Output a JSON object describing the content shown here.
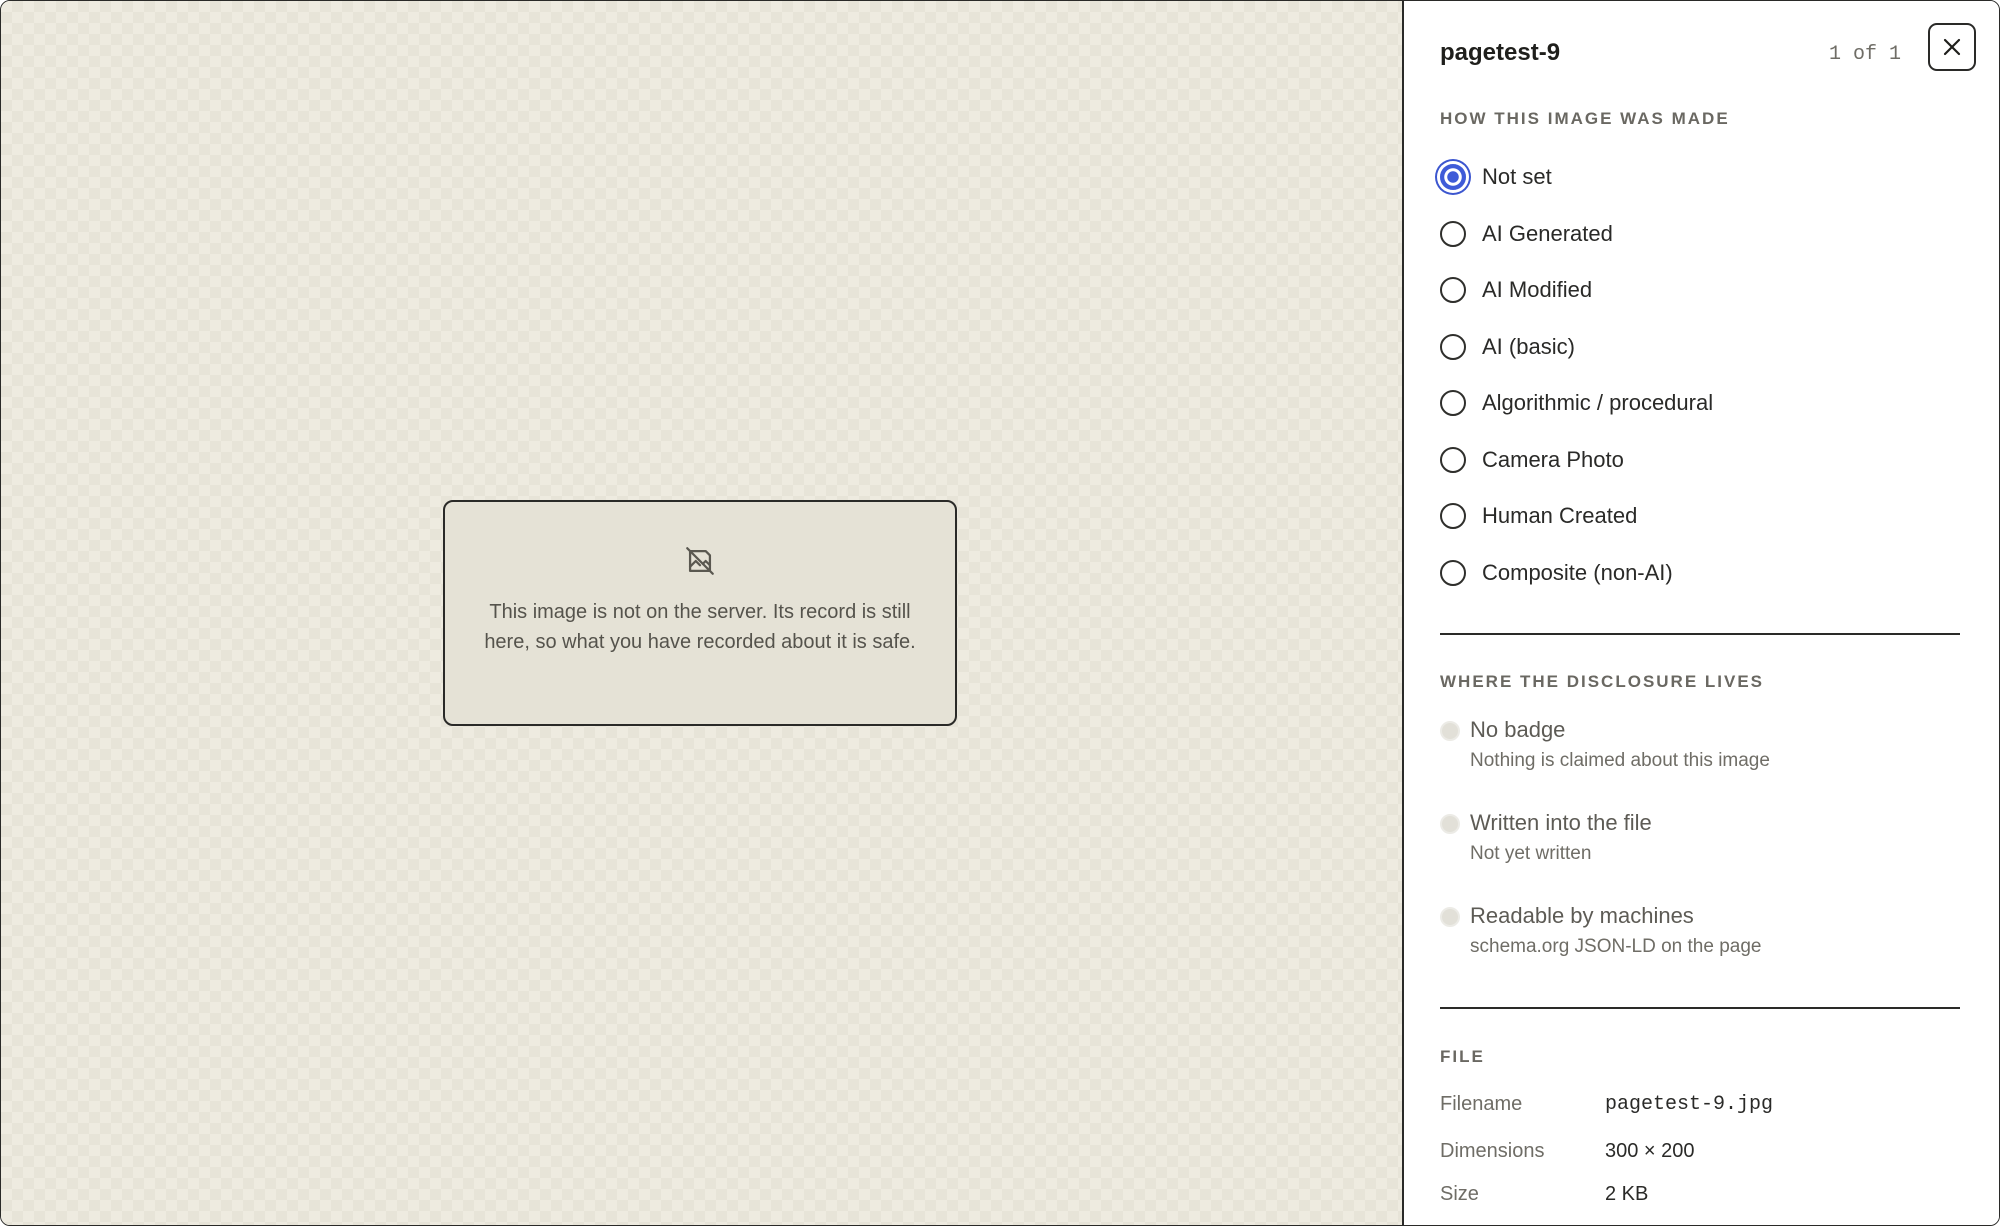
{
  "preview": {
    "missing_message": "This image is not on the server. Its record is still here, so what you have recorded about it is safe.",
    "missing_icon": "image-off-icon"
  },
  "panel": {
    "title": "pagetest-9",
    "counter": "1 of 1",
    "close_icon": "close-icon"
  },
  "provenance": {
    "heading": "HOW THIS IMAGE WAS MADE",
    "selected": "Not set",
    "options": [
      "Not set",
      "AI Generated",
      "AI Modified",
      "AI (basic)",
      "Algorithmic / procedural",
      "Camera Photo",
      "Human Created",
      "Composite (non-AI)"
    ]
  },
  "disclosure": {
    "heading": "WHERE THE DISCLOSURE LIVES",
    "items": [
      {
        "label": "No badge",
        "sub": "Nothing is claimed about this image"
      },
      {
        "label": "Written into the file",
        "sub": "Not yet written"
      },
      {
        "label": "Readable by machines",
        "sub": "schema.org JSON-LD on the page"
      }
    ]
  },
  "file": {
    "heading": "FILE",
    "rows": [
      {
        "key": "Filename",
        "value": "pagetest-9.jpg"
      },
      {
        "key": "Dimensions",
        "value": "300 × 200"
      },
      {
        "key": "Size",
        "value": "2 KB"
      }
    ]
  },
  "colors": {
    "accent": "#3f5bd8",
    "border": "#2a2a28",
    "preview_bg": "#eeebe0"
  }
}
